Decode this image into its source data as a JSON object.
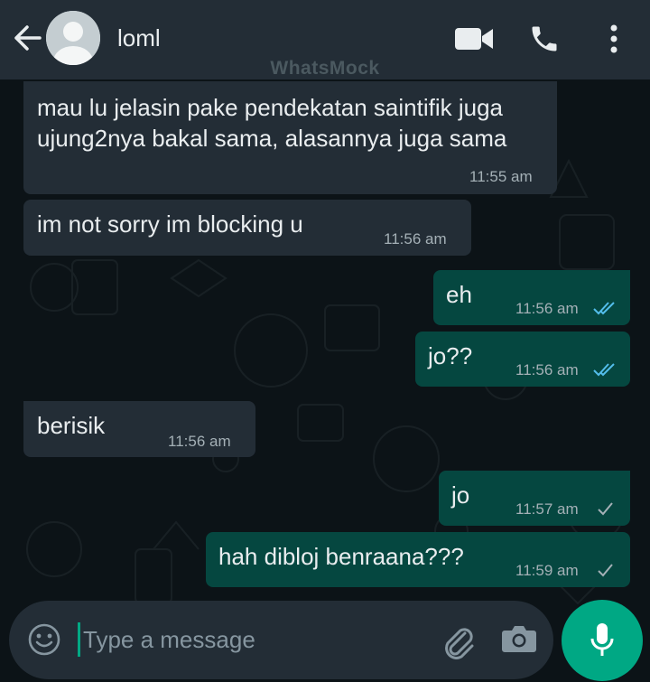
{
  "header": {
    "contact_name": "loml",
    "watermark": "WhatsMock",
    "icons": [
      "back-arrow-icon",
      "avatar",
      "video-call-icon",
      "voice-call-icon",
      "more-options-icon"
    ]
  },
  "messages": [
    {
      "direction": "in",
      "lines": [
        "mau lu jelasin pake pendekatan saintifik juga",
        "ujung2nya bakal sama, alasannya juga sama"
      ],
      "time": "11:55 am"
    },
    {
      "direction": "in",
      "text": "im not sorry im blocking u",
      "time": "11:56 am"
    },
    {
      "direction": "out",
      "text": "eh",
      "time": "11:56 am",
      "status": "read"
    },
    {
      "direction": "out",
      "text": "jo??",
      "time": "11:56 am",
      "status": "read"
    },
    {
      "direction": "in",
      "text": "berisik",
      "time": "11:56 am"
    },
    {
      "direction": "out",
      "text": "jo",
      "time": "11:57 am",
      "status": "delivered"
    },
    {
      "direction": "out",
      "text": "hah dibloj benraana???",
      "time": "11:59 am",
      "status": "delivered"
    }
  ],
  "composer": {
    "placeholder": "Type a message",
    "icons": [
      "emoji-icon",
      "attach-icon",
      "camera-icon",
      "mic-icon"
    ]
  },
  "colors": {
    "header_bg": "#232d36",
    "incoming_bubble": "#232d36",
    "outgoing_bubble": "#054740",
    "read_tick": "#53bdeb",
    "accent": "#00a884"
  }
}
